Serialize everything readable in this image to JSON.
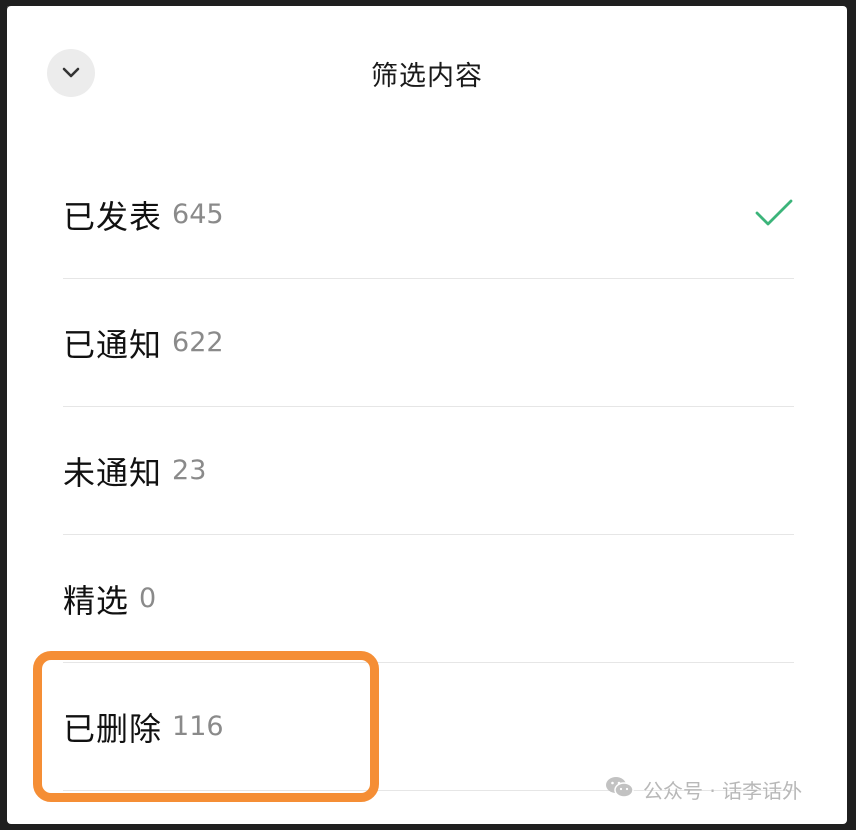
{
  "header": {
    "title": "筛选内容"
  },
  "filters": [
    {
      "label": "已发表",
      "count": "645",
      "selected": true
    },
    {
      "label": "已通知",
      "count": "622",
      "selected": false
    },
    {
      "label": "未通知",
      "count": "23",
      "selected": false
    },
    {
      "label": "精选",
      "count": "0",
      "selected": false
    },
    {
      "label": "已删除",
      "count": "116",
      "selected": false
    }
  ],
  "watermark": {
    "text": "公众号 · 话李话外",
    "icon": "wechat-icon"
  },
  "colors": {
    "check": "#3cb47a",
    "highlight": "#f58e35"
  }
}
